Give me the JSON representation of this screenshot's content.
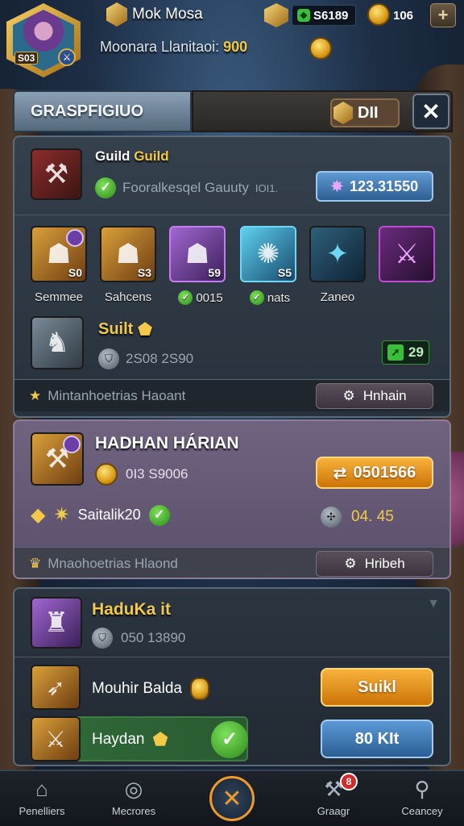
{
  "topbar": {
    "player_name": "Mok Mosa",
    "avatar_level": "S03",
    "gems_value": "S6189",
    "coins_value": "106",
    "plus_label": "+",
    "subtitle_label": "Moonara Llanitaoi:",
    "subtitle_value": "900"
  },
  "panel": {
    "title": "GRASPFIGIUO",
    "header_res_value": "DII",
    "close_label": "✕"
  },
  "card1": {
    "title_white": "Guild",
    "title_gold": "Guild",
    "desc": "Fooralkesqel Gauuty",
    "desc_extra": "IOI1.",
    "value_pill": "123.31550",
    "heroes": [
      {
        "name": "Semmee",
        "num": "S0"
      },
      {
        "name": "Sahcens",
        "num": "S3"
      },
      {
        "name": "0015",
        "num": "59"
      },
      {
        "name": "nats",
        "num": "S5"
      },
      {
        "name": "Zaneo",
        "num": ""
      },
      {
        "name": "",
        "num": ""
      }
    ],
    "sub_title": "Suilt",
    "sub_stats": "2S08  2S90",
    "green_badge": "29",
    "footer_text": "Mintanhoetrias Haoant",
    "footer_btn": "Hnhain"
  },
  "card2": {
    "title": "HADHAN HÁRIAN",
    "row1_value": "0I3  S9006",
    "orange_pill": "0501566",
    "row2_text": "Saitalik20",
    "row2_value": "04. 45",
    "footer_text": "Mnaohoetrias Hlaond",
    "footer_btn": "Hribeh"
  },
  "card3": {
    "title": "HaduKa it",
    "stats": "050  13890",
    "item1_name": "Mouhir Balda",
    "item1_btn": "Suikl",
    "item2_name": "Haydan",
    "item2_btn": "80 KIt"
  },
  "bottomnav": {
    "items": [
      {
        "label": "Penelliers",
        "icon": "home-icon"
      },
      {
        "label": "Mecrores",
        "icon": "target-icon"
      },
      {
        "label": "Graagr",
        "icon": "forge-icon"
      },
      {
        "label": "Ceancey",
        "icon": "profile-icon"
      }
    ],
    "notif_count": "8"
  },
  "colors": {
    "accent_gold": "#f2c948",
    "accent_orange": "#f09a2b",
    "accent_blue": "#5f9ad2",
    "green": "#3bbf3b"
  }
}
